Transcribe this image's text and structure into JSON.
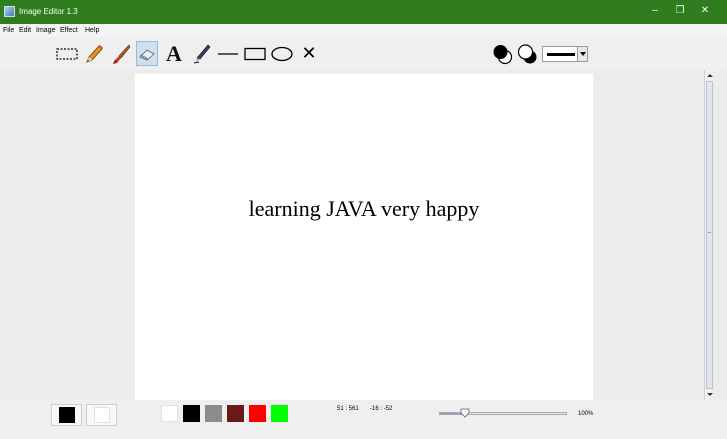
{
  "window": {
    "title": "Image Editor 1.3",
    "controls": {
      "minimize": "–",
      "maximize": "❐",
      "close": "✕"
    }
  },
  "menu": [
    "File",
    "Edit",
    "Image",
    "Effect",
    "Help"
  ],
  "toolbar": {
    "tools": [
      {
        "name": "select",
        "icon": "selection-rect-icon",
        "active": false
      },
      {
        "name": "pencil",
        "icon": "pencil-icon",
        "active": false
      },
      {
        "name": "brush",
        "icon": "brush-icon",
        "active": false
      },
      {
        "name": "eraser",
        "icon": "eraser-icon",
        "active": true
      },
      {
        "name": "text",
        "icon": "text-icon",
        "label": "A",
        "active": false
      },
      {
        "name": "pen",
        "icon": "pen-icon",
        "active": false
      },
      {
        "name": "line",
        "icon": "line-icon",
        "active": false
      },
      {
        "name": "rectangle",
        "icon": "rectangle-icon",
        "active": false
      },
      {
        "name": "ellipse",
        "icon": "ellipse-icon",
        "active": false
      },
      {
        "name": "clear",
        "icon": "close-x-icon",
        "label": "✕",
        "active": false
      }
    ],
    "fill_modes": [
      "fill-outline-icon",
      "outline-fill-icon"
    ],
    "stroke_width": "thick"
  },
  "canvas": {
    "text": "learning JAVA very happy"
  },
  "status": {
    "foreground_color": "#000000",
    "background_color": "#ffffff",
    "palette": [
      "#ffffff",
      "#000000",
      "#8c8c8c",
      "#6b1a1a",
      "#ff0000",
      "#00ff00"
    ],
    "canvas_size": "51 : 561",
    "cursor_position": "-16 : -52",
    "zoom": "100%",
    "zoom_fraction": 0.2
  }
}
